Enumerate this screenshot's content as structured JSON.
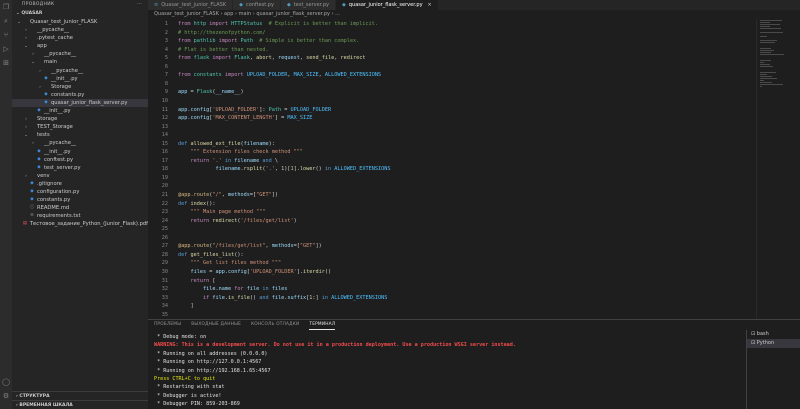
{
  "explorer": {
    "title": "ПРОВОДНИК",
    "root_label": "QUASAR",
    "tree": [
      {
        "label": "Quasar_test_junior_FLASK",
        "indent": 0,
        "chev": "⌄",
        "icon": "",
        "color": "#cccccc"
      },
      {
        "label": "__pycache__",
        "indent": 1,
        "chev": "›",
        "icon": "",
        "color": "#cccccc"
      },
      {
        "label": ".pytest_cache",
        "indent": 1,
        "chev": "›",
        "icon": "",
        "color": "#cccccc"
      },
      {
        "label": "app",
        "indent": 1,
        "chev": "⌄",
        "icon": "",
        "color": "#cccccc"
      },
      {
        "label": "__pycache__",
        "indent": 2,
        "chev": "›",
        "icon": "",
        "color": "#cccccc"
      },
      {
        "label": "main",
        "indent": 2,
        "chev": "⌄",
        "icon": "",
        "color": "#cccccc"
      },
      {
        "label": "__pycache__",
        "indent": 3,
        "chev": "›",
        "icon": "",
        "color": "#cccccc"
      },
      {
        "label": "__init__.py",
        "indent": 3,
        "chev": "",
        "icon": "◆",
        "color": "#cccccc"
      },
      {
        "label": "Storage",
        "indent": 3,
        "chev": "›",
        "icon": "",
        "color": "#cccccc"
      },
      {
        "label": "constants.py",
        "indent": 3,
        "chev": "",
        "icon": "◆",
        "color": "#cccccc"
      },
      {
        "label": "quasar_junior_flask_server.py",
        "indent": 3,
        "chev": "",
        "icon": "◆",
        "color": "#cccccc",
        "selected": true
      },
      {
        "label": "__init__.py",
        "indent": 2,
        "chev": "",
        "icon": "◆",
        "color": "#cccccc"
      },
      {
        "label": "Storage",
        "indent": 1,
        "chev": "›",
        "icon": "",
        "color": "#cccccc"
      },
      {
        "label": "TEST_Storage",
        "indent": 1,
        "chev": "›",
        "icon": "",
        "color": "#cccccc"
      },
      {
        "label": "tests",
        "indent": 1,
        "chev": "⌄",
        "icon": "",
        "color": "#cccccc"
      },
      {
        "label": "__pycache__",
        "indent": 2,
        "chev": "›",
        "icon": "",
        "color": "#cccccc"
      },
      {
        "label": "__init__.py",
        "indent": 2,
        "chev": "",
        "icon": "◆",
        "color": "#cccccc"
      },
      {
        "label": "conftest.py",
        "indent": 2,
        "chev": "",
        "icon": "◆",
        "color": "#cccccc"
      },
      {
        "label": "test_server.py",
        "indent": 2,
        "chev": "",
        "icon": "◆",
        "color": "#cccccc"
      },
      {
        "label": "venv",
        "indent": 1,
        "chev": "›",
        "icon": "",
        "color": "#cccccc"
      },
      {
        "label": ".gitignore",
        "indent": 1,
        "chev": "",
        "icon": "◆",
        "color": "#cccccc"
      },
      {
        "label": "configuration.py",
        "indent": 1,
        "chev": "",
        "icon": "◆",
        "color": "#cccccc"
      },
      {
        "label": "constants.py",
        "indent": 1,
        "chev": "",
        "icon": "◆",
        "color": "#cccccc"
      },
      {
        "label": "README.md",
        "indent": 1,
        "chev": "",
        "icon": "ⓘ",
        "color": "#cccccc"
      },
      {
        "label": "requirements.txt",
        "indent": 1,
        "chev": "",
        "icon": "≡",
        "color": "#cccccc"
      },
      {
        "label": "Тестовое_задание_Python_(Junior_Flask).pdf",
        "indent": 0,
        "chev": "",
        "icon": "▤",
        "color": "#cccccc"
      }
    ],
    "bottom_sections": [
      "СТРУКТУРА",
      "ВРЕМЕННАЯ ШКАЛА"
    ]
  },
  "tabs": [
    {
      "label": "Quasar_test_junior_FLASK",
      "active": false
    },
    {
      "label": "conftest.py",
      "active": false
    },
    {
      "label": "test_server.py",
      "active": false
    },
    {
      "label": "quasar_junior_flask_server.py",
      "active": true
    }
  ],
  "breadcrumb": "Quasar_test_junior_FLASK › app › main › quasar_junior_flask_server.py › ...",
  "editor": {
    "lines": [
      {
        "n": "1",
        "html": "<span class='kw'>from</span> <span class='cl'>http</span> <span class='kw'>import</span> <span class='cl'>HTTPStatus</span>  <span class='cm'># Explicit is better than implicit.</span>"
      },
      {
        "n": "2",
        "html": "<span class='cm'># http://thezenofpython.com/</span>"
      },
      {
        "n": "3",
        "html": "<span class='kw'>from</span> <span class='cl'>pathlib</span> <span class='kw'>import</span> <span class='cl'>Path</span>  <span class='cm'># Simple is better than complex.</span>"
      },
      {
        "n": "4",
        "html": "<span class='cm'># Flat is better than nested.</span>"
      },
      {
        "n": "5",
        "html": "<span class='kw'>from</span> <span class='cl'>flask</span> <span class='kw'>import</span> <span class='cl'>Flask</span>, <span class='fn'>abort</span>, <span class='vr'>request</span>, <span class='fn'>send_file</span>, <span class='fn'>redirect</span>"
      },
      {
        "n": "6",
        "html": ""
      },
      {
        "n": "7",
        "html": "<span class='kw'>from</span> <span class='cl'>constants</span> <span class='kw'>import</span> <span class='cn'>UPLOAD_FOLDER</span>, <span class='cn'>MAX_SIZE</span>, <span class='cn'>ALLOWED_EXTENSIONS</span>"
      },
      {
        "n": "8",
        "html": ""
      },
      {
        "n": "9",
        "html": "<span class='vr'>app</span> = <span class='cl'>Flask</span>(<span class='vr'>__name__</span>)"
      },
      {
        "n": "10",
        "html": ""
      },
      {
        "n": "11",
        "html": "<span class='vr'>app</span>.<span class='vr'>config</span>[<span class='st'>'UPLOAD_FOLDER'</span>]: <span class='cl'>Path</span> = <span class='cn'>UPLOAD_FOLDER</span>"
      },
      {
        "n": "12",
        "html": "<span class='vr'>app</span>.<span class='vr'>config</span>[<span class='st'>'MAX_CONTENT_LENGTH'</span>] = <span class='cn'>MAX_SIZE</span>"
      },
      {
        "n": "13",
        "html": ""
      },
      {
        "n": "14",
        "html": ""
      },
      {
        "n": "15",
        "html": "<span class='kb'>def</span> <span class='fn'>allowed_ext_file</span>(<span class='vr'>filename</span>):"
      },
      {
        "n": "16",
        "html": "    <span class='st'>\"\"\" Extension files check method \"\"\"</span>"
      },
      {
        "n": "17",
        "html": "    <span class='kw'>return</span> <span class='st'>'.'</span> <span class='kb'>in</span> <span class='vr'>filename</span> <span class='kb'>and</span> \\"
      },
      {
        "n": "18",
        "html": "            <span class='vr'>filename</span>.<span class='fn'>rsplit</span>(<span class='st'>'.'</span>, <span class='nm'>1</span>)[<span class='nm'>1</span>].<span class='fn'>lower</span>() <span class='kb'>in</span> <span class='cn'>ALLOWED_EXTENSIONS</span>"
      },
      {
        "n": "19",
        "html": ""
      },
      {
        "n": "20",
        "html": ""
      },
      {
        "n": "21",
        "html": "<span class='dc'>@app.route</span>(<span class='st'>\"/\"</span>, <span class='vr'>methods</span>=[<span class='st'>\"GET\"</span>])"
      },
      {
        "n": "22",
        "html": "<span class='kb'>def</span> <span class='fn'>index</span>():"
      },
      {
        "n": "23",
        "html": "    <span class='st'>\"\"\" Main page method \"\"\"</span>"
      },
      {
        "n": "24",
        "html": "    <span class='kw'>return</span> <span class='fn'>redirect</span>(<span class='st'>'/files/get/list'</span>)"
      },
      {
        "n": "25",
        "html": ""
      },
      {
        "n": "26",
        "html": ""
      },
      {
        "n": "27",
        "html": "<span class='dc'>@app.route</span>(<span class='st'>\"/files/get/list\"</span>, <span class='vr'>methods</span>=[<span class='st'>\"GET\"</span>])"
      },
      {
        "n": "28",
        "html": "<span class='kb'>def</span> <span class='fn'>get_files_list</span>():"
      },
      {
        "n": "29",
        "html": "    <span class='st'>\"\"\" Get list files method \"\"\"</span>"
      },
      {
        "n": "30",
        "html": "    <span class='vr'>files</span> = <span class='vr'>app</span>.<span class='vr'>config</span>[<span class='st'>'UPLOAD_FOLDER'</span>].<span class='fn'>iterdir</span>()"
      },
      {
        "n": "31",
        "html": "    <span class='kw'>return</span> ["
      },
      {
        "n": "32",
        "html": "        <span class='vr'>file</span>.<span class='vr'>name</span> <span class='kw'>for</span> <span class='vr'>file</span> <span class='kb'>in</span> <span class='vr'>files</span>"
      },
      {
        "n": "33",
        "html": "        <span class='kw'>if</span> <span class='vr'>file</span>.<span class='fn'>is_file</span>() <span class='kb'>and</span> <span class='vr'>file</span>.<span class='vr'>suffix</span>[<span class='nm'>1</span>:] <span class='kb'>in</span> <span class='cn'>ALLOWED_EXTENSIONS</span>"
      },
      {
        "n": "34",
        "html": "    ]"
      },
      {
        "n": "35",
        "html": ""
      }
    ]
  },
  "panel": {
    "tabs": [
      {
        "label": "ПРОБЛЕМЫ",
        "active": false
      },
      {
        "label": "ВЫХОДНЫЕ ДАННЫЕ",
        "active": false
      },
      {
        "label": "КОНСОЛЬ ОТЛАДКИ",
        "active": false
      },
      {
        "label": "ТЕРМИНАЛ",
        "active": true
      }
    ],
    "terminal_lines": [
      {
        "text": " * Debug mode: on",
        "cls": "norm"
      },
      {
        "text": "WARNING: This is a development server. Do not use it in a production deployment. Use a production WSGI server instead.",
        "cls": "warn"
      },
      {
        "text": " * Running on all addresses (0.0.0.0)",
        "cls": "norm"
      },
      {
        "text": " * Running on http://127.0.0.1:4567",
        "cls": "norm"
      },
      {
        "text": " * Running on http://192.168.1.65:4567",
        "cls": "norm"
      },
      {
        "text": "Press CTRL+C to quit",
        "cls": "yel"
      },
      {
        "text": " * Restarting with stat",
        "cls": "norm"
      },
      {
        "text": " * Debugger is active!",
        "cls": "norm"
      },
      {
        "text": " * Debugger PIN: 859-203-869",
        "cls": "norm"
      }
    ],
    "terminals": [
      {
        "label": "bash",
        "active": false
      },
      {
        "label": "Python",
        "active": true
      }
    ]
  },
  "colors": {
    "accent": "#007acc",
    "warning": "#f14c4c"
  }
}
